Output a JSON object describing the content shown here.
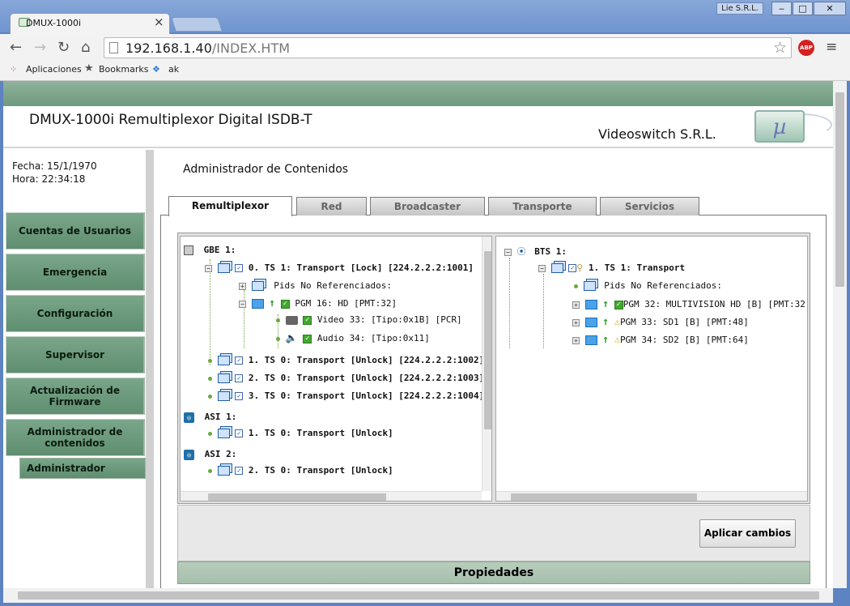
{
  "browser": {
    "tab_title": "DMUX-1000i",
    "url_host": "192.168.1.40",
    "url_path": "/INDEX.HTM",
    "user": "Lie S.R.L.",
    "bookmarks": [
      "Aplicaciones",
      "Bookmarks",
      "ak"
    ],
    "abp": "ABP"
  },
  "header": {
    "title": "DMUX-1000i Remultiplexor Digital ISDB-T",
    "company": "Videoswitch S.R.L."
  },
  "sidebar": {
    "fecha": "Fecha: 15/1/1970",
    "hora": "Hora: 22:34:18",
    "items": [
      "Cuentas de Usuarios",
      "Emergencia",
      "Configuración",
      "Supervisor",
      "Actualización de Firmware",
      "Administrador de contenidos"
    ],
    "sub_item": "Administrador"
  },
  "main": {
    "title": "Administrador de Contenidos",
    "tabs": [
      "Remultiplexor",
      "Red",
      "Broadcaster",
      "Transporte",
      "Servicios"
    ],
    "apply_button": "Aplicar cambios",
    "properties": "Propiedades"
  },
  "left_tree": {
    "gbe": "GBE 1:",
    "ts0": "0. TS 1: Transport [Lock] [224.2.2.2:1001]",
    "pids": "Pids No Referenciados:",
    "pgm16": "PGM 16: HD [PMT:32]",
    "video": "Video 33: [Tipo:0x1B] [PCR]",
    "audio": "Audio 34: [Tipo:0x11]",
    "ts1": "1. TS 0: Transport [Unlock] [224.2.2.2:1002]",
    "ts2": "2. TS 0: Transport [Unlock] [224.2.2.2:1003]",
    "ts3": "3. TS 0: Transport [Unlock] [224.2.2.2:1004]",
    "asi1": "ASI 1:",
    "asi1_ts": "1. TS 0: Transport [Unlock]",
    "asi2": "ASI 2:",
    "asi2_ts": "2. TS 0: Transport [Unlock]"
  },
  "right_tree": {
    "bts": "BTS 1:",
    "ts": "1. TS 1: Transport",
    "pids": "Pids No Referenciados:",
    "pgm32": "PGM 32: MULTIVISION HD [B] [PMT:32",
    "pgm33": "PGM 33: SD1 [B] [PMT:48]",
    "pgm34": "PGM 34: SD2 [B] [PMT:64]"
  }
}
